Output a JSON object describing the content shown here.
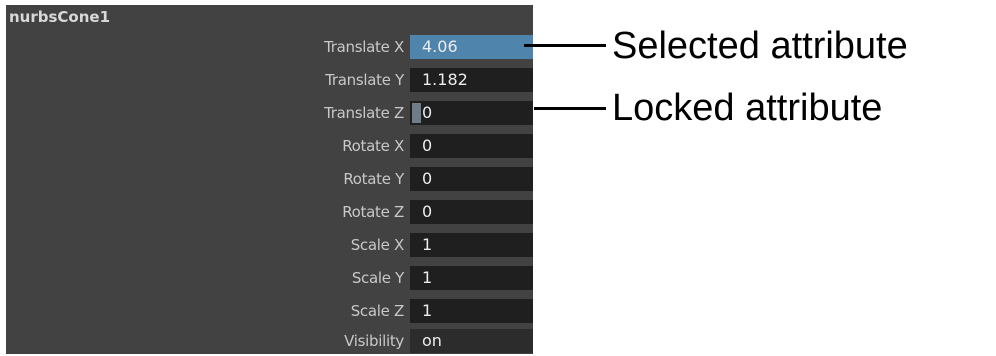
{
  "node": {
    "name": "nurbsCone1"
  },
  "attributes": [
    {
      "label": "Translate X",
      "value": "4.06",
      "state": "selected"
    },
    {
      "label": "Translate Y",
      "value": "1.182",
      "state": "normal"
    },
    {
      "label": "Translate Z",
      "value": "0",
      "state": "locked"
    },
    {
      "label": "Rotate X",
      "value": "0",
      "state": "normal"
    },
    {
      "label": "Rotate Y",
      "value": "0",
      "state": "normal"
    },
    {
      "label": "Rotate Z",
      "value": "0",
      "state": "normal"
    },
    {
      "label": "Scale X",
      "value": "1",
      "state": "normal"
    },
    {
      "label": "Scale Y",
      "value": "1",
      "state": "normal"
    },
    {
      "label": "Scale Z",
      "value": "1",
      "state": "normal"
    },
    {
      "label": "Visibility",
      "value": "on",
      "state": "normal"
    }
  ],
  "callouts": {
    "selected": "Selected attribute",
    "locked": "Locked attribute"
  },
  "colors": {
    "panel_bg": "#424242",
    "field_bg": "#1f1f1f",
    "selected_field": "#4f84ad",
    "lock_indicator": "#6f7c8a"
  }
}
